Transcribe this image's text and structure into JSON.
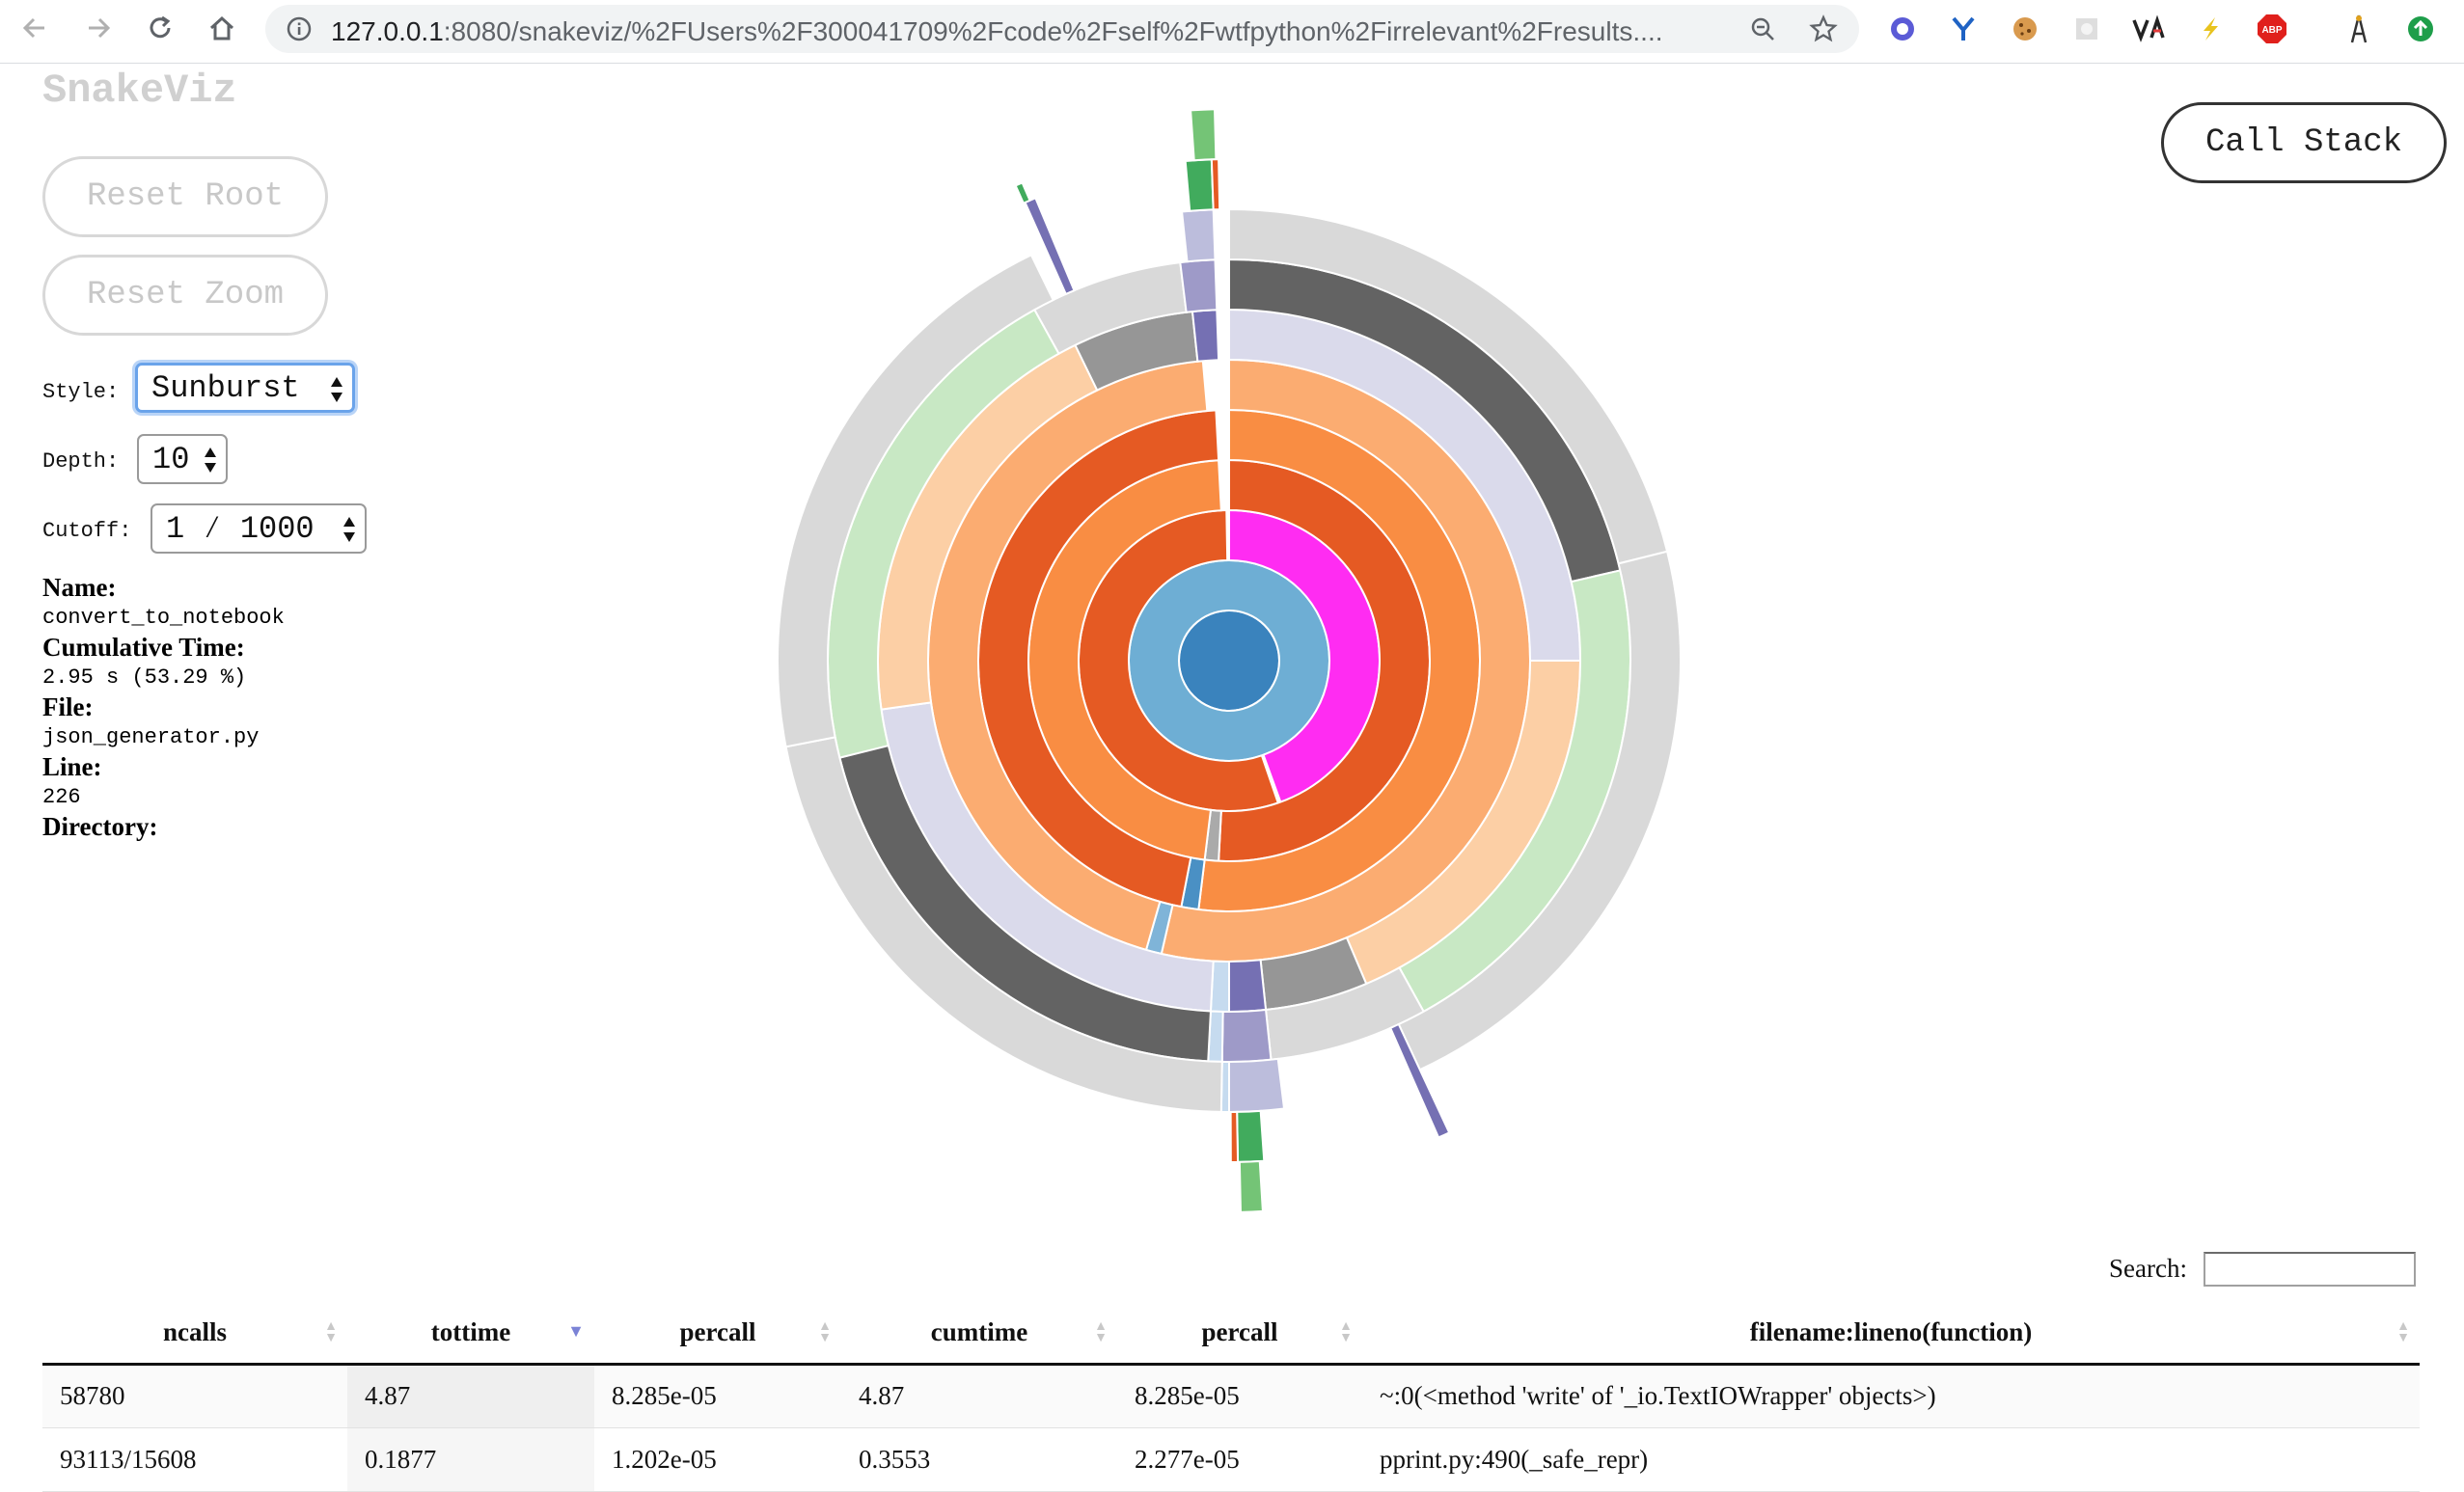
{
  "browser": {
    "url_host": "127.0.0.1",
    "url_rest": ":8080/snakeviz/%2FUsers%2F300041709%2Fcode%2Fself%2Fwtfpython%2Firrelevant%2Fresults....",
    "extensions": [
      "shield-ext",
      "y-ext",
      "cookie-ext",
      "gray-ext",
      "via-ext",
      "bolt-ext",
      "abp-ext",
      "tower-ext",
      "update-ext"
    ]
  },
  "app": {
    "logo": "SnakeViz",
    "reset_root": "Reset Root",
    "reset_zoom": "Reset Zoom",
    "call_stack": "Call Stack"
  },
  "controls": {
    "style_label": "Style:",
    "style_value": "Sunburst",
    "depth_label": "Depth:",
    "depth_value": "10",
    "cutoff_label": "Cutoff:",
    "cutoff_value": "1 ⁄ 1000"
  },
  "info": {
    "name_label": "Name:",
    "name_value": "convert_to_notebook",
    "cumtime_label": "Cumulative Time:",
    "cumtime_value": "2.95 s (53.29 %)",
    "file_label": "File:",
    "file_value": "json_generator.py",
    "line_label": "Line:",
    "line_value": "226",
    "directory_label": "Directory:"
  },
  "search": {
    "label": "Search:"
  },
  "table": {
    "headers": [
      "ncalls",
      "tottime",
      "percall",
      "cumtime",
      "percall",
      "filename:lineno(function)"
    ],
    "sorted_column": "tottime",
    "rows": [
      [
        "58780",
        "4.87",
        "8.285e-05",
        "4.87",
        "8.285e-05",
        "~:0(<method 'write' of '_io.TextIOWrapper' objects>)"
      ],
      [
        "93113/15608",
        "0.1877",
        "1.202e-05",
        "0.3553",
        "2.277e-05",
        "pprint.py:490(_safe_repr)"
      ]
    ]
  },
  "colors": {
    "center": "#3a83bd",
    "ring1": "#6eaed4",
    "magenta": "#ff2cf2",
    "orange_dark": "#e55a23",
    "orange": "#f98d43",
    "orange_light": "#fbac71",
    "peach": "#fccfa5",
    "green_light": "#c8e8c4",
    "gray_light": "#d9d9d9",
    "gray_dark": "#636363",
    "gray_mid": "#969696",
    "lavender": "#dadaeb",
    "purple": "#7570b3",
    "purple_light": "#9e9ac8",
    "purple_pale": "#bcbddc",
    "green": "#41ab5d",
    "green_mid": "#74c476"
  }
}
